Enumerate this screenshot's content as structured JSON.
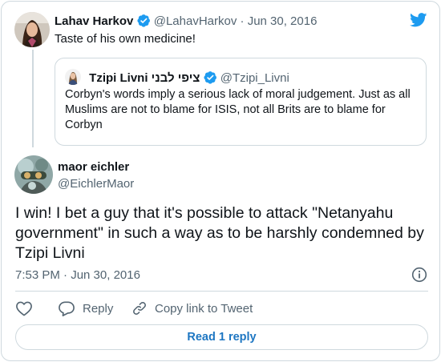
{
  "parent_tweet": {
    "author_name": "Lahav Harkov",
    "author_handle": "@LahavHarkov",
    "separator": "·",
    "date": "Jun 30, 2016",
    "text": "Taste of his own medicine!"
  },
  "quoted_tweet": {
    "author_name": "Tzipi Livni ציפי לבני",
    "author_handle": "@Tzipi_Livni",
    "text": "Corbyn's words imply a serious lack of moral judgement. Just as all Muslims are not to blame for ISIS, not all Brits are to blame for Corbyn"
  },
  "main_tweet": {
    "author_name": "maor eichler",
    "author_handle": "@EichlerMaor",
    "text": "I win! I bet a guy that it's possible to attack \"Netanyahu government\" in such a way as to be harshly condemned by Tzipi Livni",
    "timestamp": "7:53 PM · Jun 30, 2016"
  },
  "actions": {
    "reply_label": "Reply",
    "copy_link_label": "Copy link to Tweet"
  },
  "read_replies_label": "Read 1 reply",
  "colors": {
    "twitter_blue": "#1d9bf0",
    "link_blue": "#1d76c2",
    "text_secondary": "#536471",
    "border": "#cfd9de"
  }
}
